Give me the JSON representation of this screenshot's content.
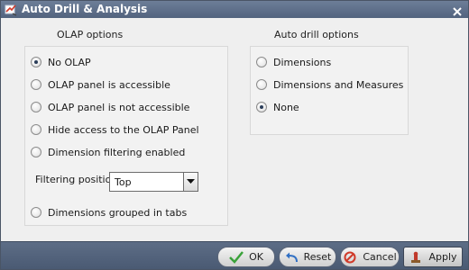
{
  "window": {
    "title": "Auto Drill & Analysis",
    "icon": "auto-drill-app-icon",
    "close_icon": "close-icon"
  },
  "olap": {
    "group_title": "OLAP options",
    "options": [
      {
        "label": "No OLAP",
        "checked": true
      },
      {
        "label": "OLAP panel is accessible",
        "checked": false
      },
      {
        "label": "OLAP panel is not accessible",
        "checked": false
      },
      {
        "label": "Hide access to the OLAP Panel",
        "checked": false
      },
      {
        "label": "Dimension filtering enabled",
        "checked": false
      }
    ],
    "filtering_position_label": "Filtering position",
    "filtering_position_value": "Top",
    "grouped_option": {
      "label": "Dimensions grouped in tabs",
      "checked": false
    }
  },
  "auto_drill": {
    "group_title": "Auto drill options",
    "options": [
      {
        "label": "Dimensions",
        "checked": false
      },
      {
        "label": "Dimensions and Measures",
        "checked": false
      },
      {
        "label": "None",
        "checked": true
      }
    ]
  },
  "footer": {
    "ok_label": "OK",
    "reset_label": "Reset",
    "cancel_label": "Cancel",
    "apply_label": "Apply"
  },
  "colors": {
    "titlebar": "#5f708b",
    "footer": "#53637c",
    "ok_icon": "#3aa23a",
    "reset_icon": "#2f6fc4",
    "cancel_icon": "#d03a2a"
  }
}
